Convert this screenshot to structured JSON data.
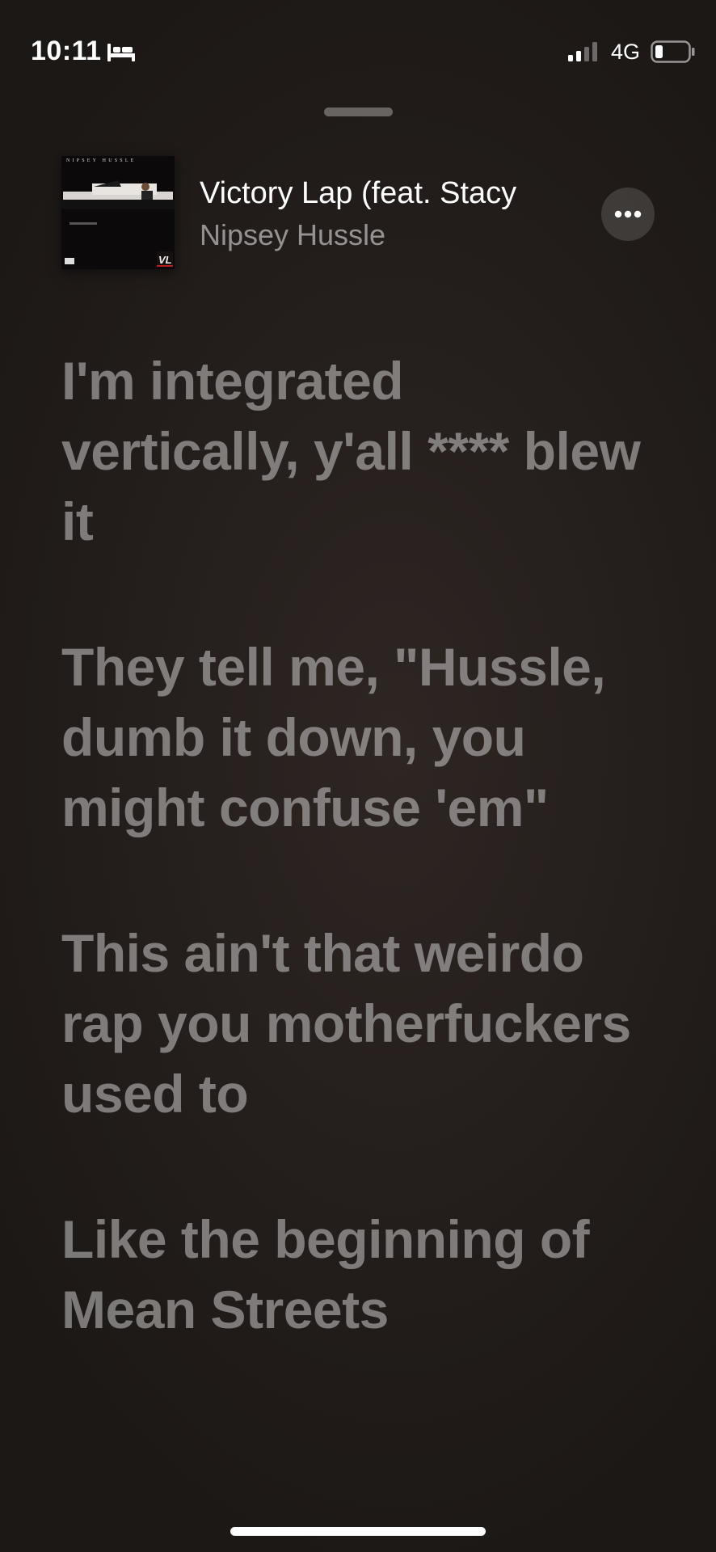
{
  "status_bar": {
    "time": "10:11",
    "network": "4G",
    "icons": [
      "bed-icon",
      "signal-icon",
      "battery-icon"
    ]
  },
  "now_playing": {
    "title": "Victory Lap (feat. Stacy",
    "artist": "Nipsey Hussle",
    "artwork": {
      "header_text": "NIPSEY HUSSLE",
      "logo_text": "VL"
    },
    "more_button_icon": "ellipsis-icon"
  },
  "lyrics": [
    "I'm integrated vertically, y'all **** blew it",
    "They tell me, \"Hussle, dumb it down, you might confuse 'em\"",
    "This ain't that weirdo rap you motherfuckers used to",
    "Like the beginning of Mean Streets"
  ],
  "colors": {
    "background": "#251f1d",
    "lyric_text": "rgba(255,255,255,0.42)",
    "artist_text": "rgba(255,255,255,0.52)"
  }
}
